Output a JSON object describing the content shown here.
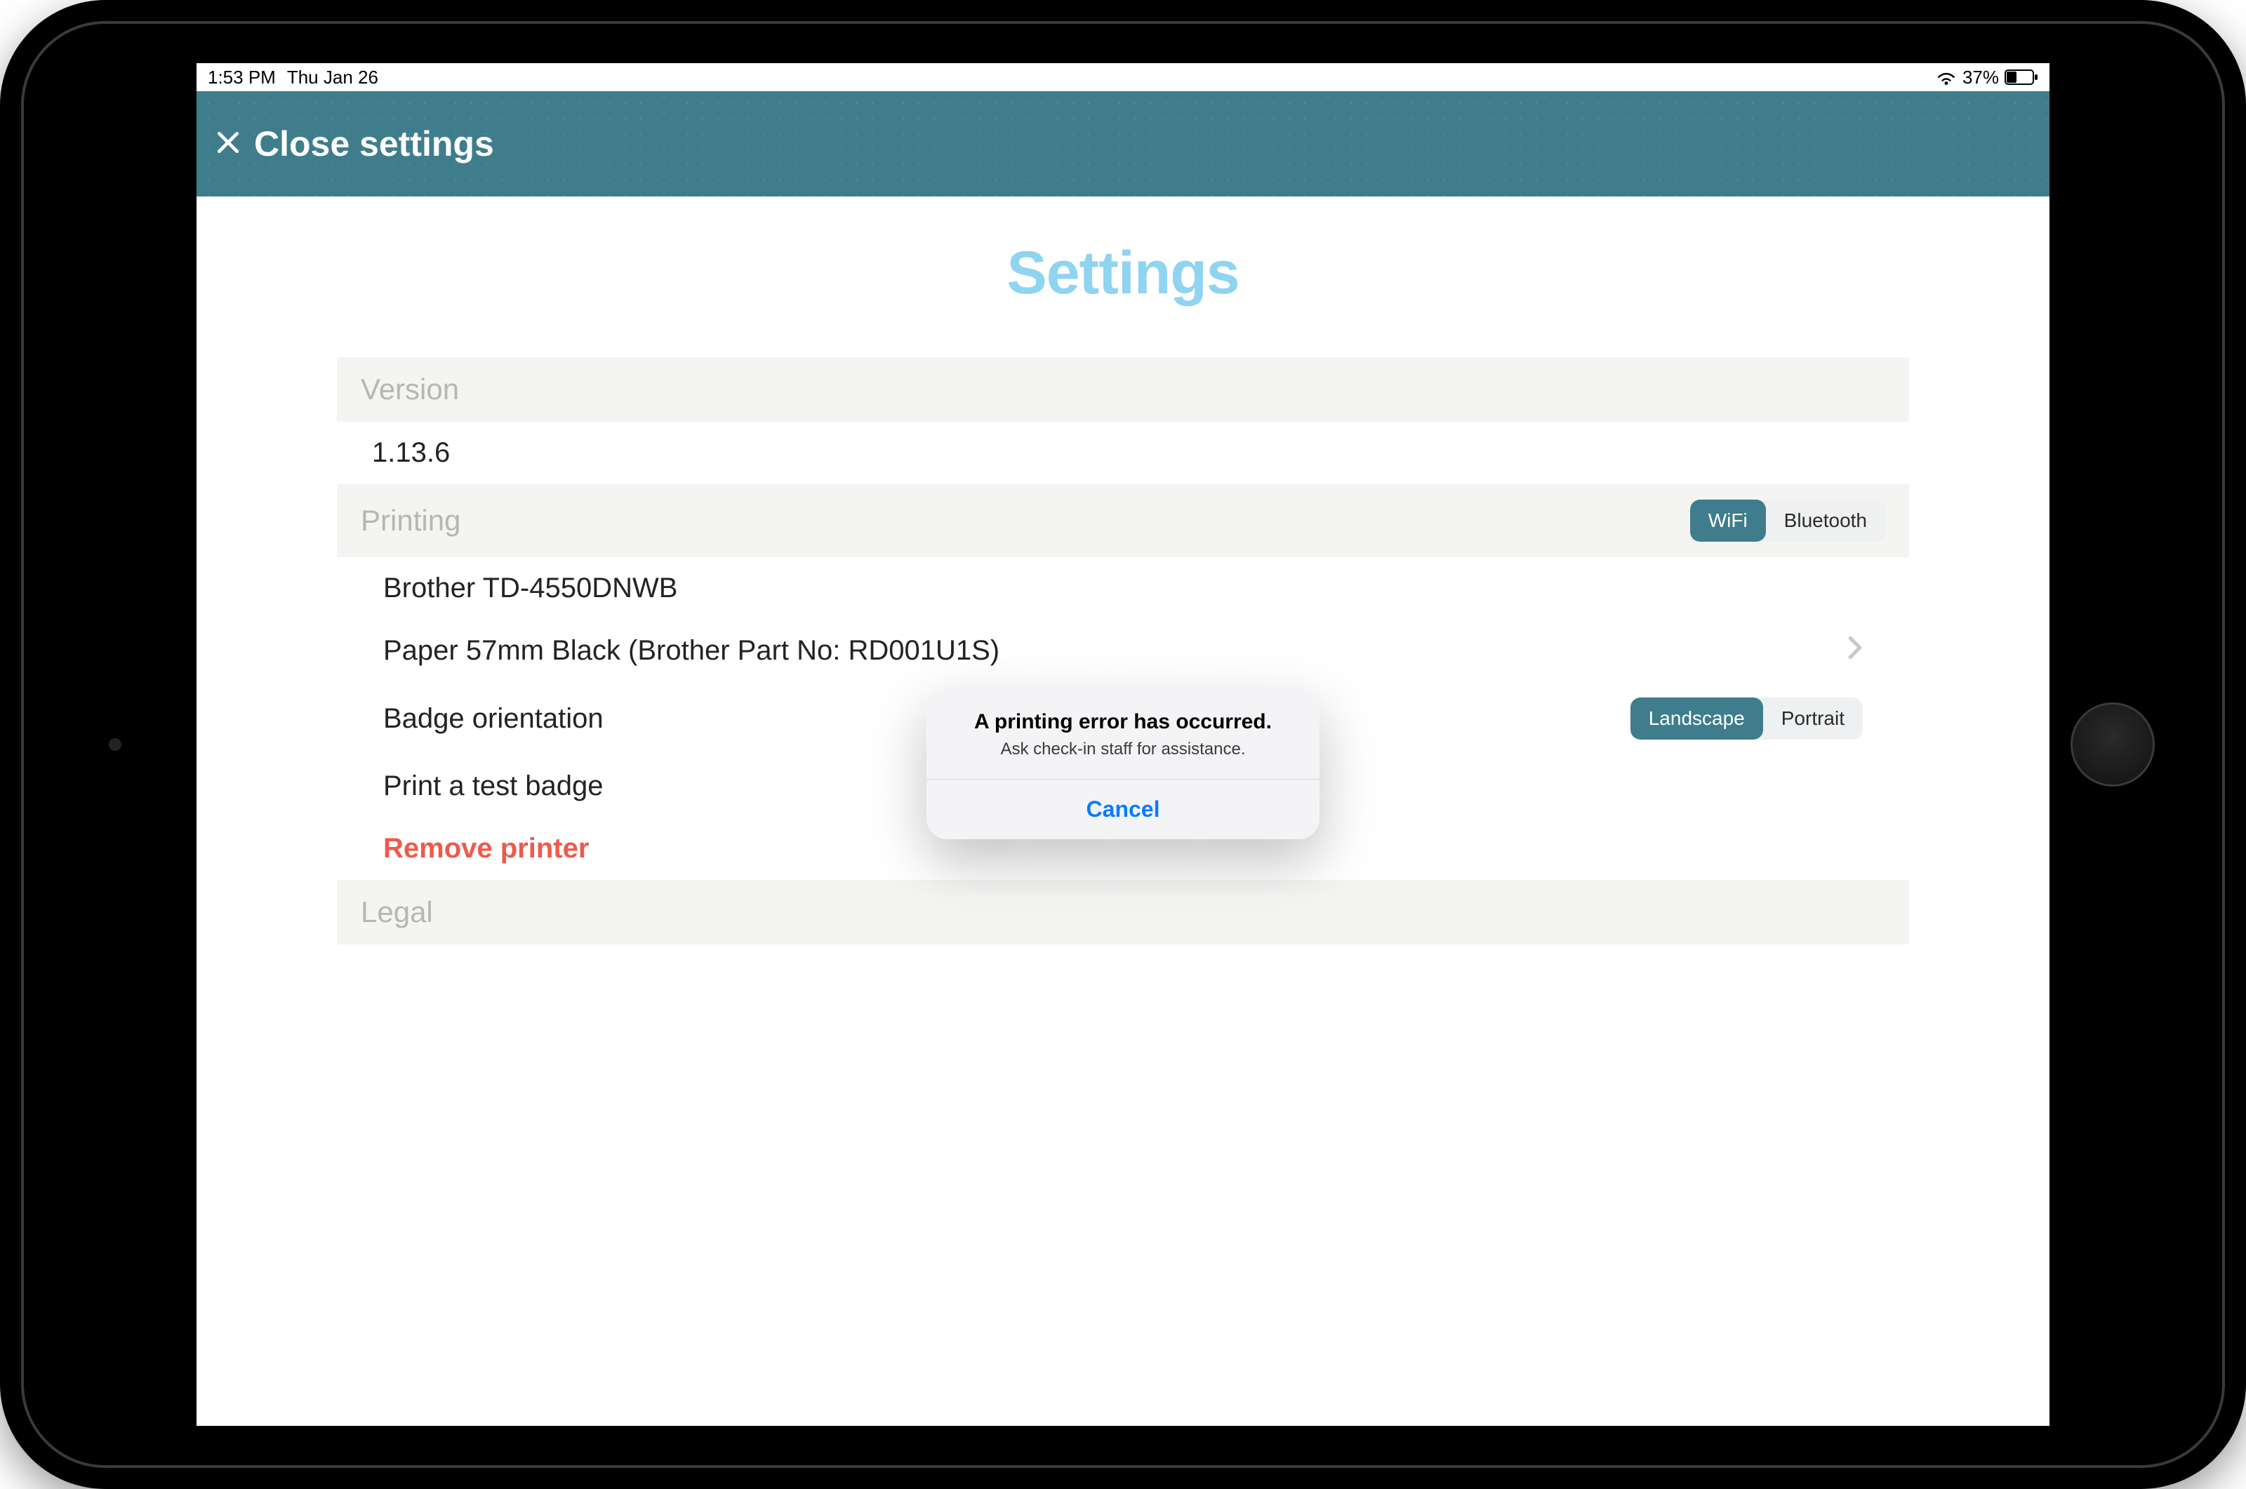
{
  "status_bar": {
    "time": "1:53 PM",
    "date": "Thu Jan 26",
    "battery_percent": "37%"
  },
  "header": {
    "close_label": "Close settings"
  },
  "page": {
    "title": "Settings"
  },
  "sections": {
    "version": {
      "header": "Version",
      "value": "1.13.6"
    },
    "printing": {
      "header": "Printing",
      "connection": {
        "options": [
          "WiFi",
          "Bluetooth"
        ],
        "selected": "WiFi"
      },
      "printer_name": "Brother TD-4550DNWB",
      "paper": "Paper 57mm Black (Brother Part No: RD001U1S)",
      "orientation": {
        "label": "Badge orientation",
        "options": [
          "Landscape",
          "Portrait"
        ],
        "selected": "Landscape"
      },
      "test_badge": "Print a test badge",
      "remove": "Remove printer"
    },
    "legal": {
      "header": "Legal"
    }
  },
  "alert": {
    "title": "A printing error has occurred.",
    "message": "Ask check-in staff for assistance.",
    "cancel": "Cancel"
  }
}
